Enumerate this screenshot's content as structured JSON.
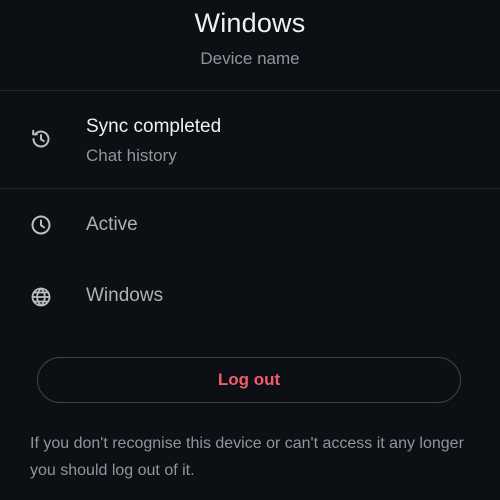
{
  "header": {
    "title": "Windows",
    "subtitle": "Device name"
  },
  "sync_row": {
    "icon": "history-icon",
    "title": "Sync completed",
    "subtitle": "Chat history"
  },
  "status_row": {
    "icon": "clock-icon",
    "label": "Active"
  },
  "platform_row": {
    "icon": "globe-icon",
    "label": "Windows"
  },
  "logout": {
    "label": "Log out"
  },
  "footnote": {
    "text": "If you don't recognise this device or can't access it any longer you should log out of it."
  },
  "colors": {
    "background": "#0c1014",
    "primary_text": "#eef0f1",
    "secondary_text": "#8e969c",
    "danger": "#f15c6d",
    "divider": "#22292e"
  }
}
